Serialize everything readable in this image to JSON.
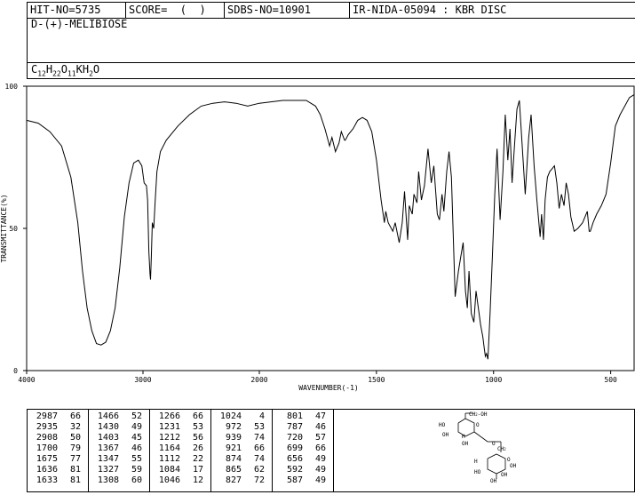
{
  "header": {
    "hit_no": "HIT-NO=5735",
    "score": "SCORE=  (  )",
    "sdbs_no": "SDBS-NO=10901",
    "ir_info": "IR-NIDA-05094 : KBR DISC"
  },
  "compound_name": "D-(+)-MELIBIOSE",
  "formula": {
    "c": "C",
    "c_n": "12",
    "h": "H",
    "h_n": "22",
    "o": "O",
    "o_n": "11",
    "k": "KH",
    "k_n": "2",
    "o2": "O"
  },
  "chart_data": {
    "type": "line",
    "xlabel": "WAVENUMBER(-1)",
    "ylabel": "TRANSMITTANCE(%)",
    "xlim": [
      4000,
      400
    ],
    "ylim": [
      0,
      100
    ],
    "x_ticks": [
      "4000",
      "3000",
      "2000",
      "1500",
      "1000",
      "500"
    ],
    "y_ticks": [
      "100",
      "50",
      "0"
    ],
    "series": [
      {
        "x": [
          4000,
          3900,
          3800,
          3700,
          3620,
          3560,
          3520,
          3480,
          3440,
          3400,
          3360,
          3320,
          3280,
          3240,
          3200,
          3160,
          3120,
          3080,
          3040,
          3010,
          2990,
          2970,
          2960,
          2950,
          2940,
          2935,
          2928,
          2920,
          2908,
          2895,
          2880,
          2850,
          2800,
          2700,
          2600,
          2500,
          2400,
          2300,
          2200,
          2100,
          2000,
          1900,
          1800,
          1760,
          1740,
          1720,
          1710,
          1700,
          1690,
          1675,
          1660,
          1650,
          1636,
          1633,
          1620,
          1600,
          1580,
          1560,
          1540,
          1520,
          1500,
          1480,
          1466,
          1460,
          1450,
          1430,
          1420,
          1403,
          1390,
          1380,
          1367,
          1360,
          1347,
          1340,
          1327,
          1320,
          1308,
          1295,
          1280,
          1266,
          1255,
          1240,
          1231,
          1220,
          1212,
          1200,
          1190,
          1180,
          1164,
          1150,
          1140,
          1130,
          1120,
          1112,
          1105,
          1095,
          1084,
          1075,
          1065,
          1055,
          1046,
          1040,
          1035,
          1030,
          1024,
          1015,
          1005,
          995,
          985,
          972,
          960,
          950,
          939,
          930,
          921,
          910,
          900,
          890,
          874,
          865,
          850,
          840,
          827,
          815,
          801,
          795,
          787,
          780,
          770,
          760,
          750,
          740,
          730,
          720,
          710,
          699,
          690,
          680,
          670,
          656,
          640,
          620,
          600,
          592,
          587,
          575,
          560,
          540,
          520,
          500,
          480,
          460,
          440,
          420,
          400
        ],
        "y": [
          88,
          87,
          84,
          79,
          68,
          52,
          35,
          22,
          14,
          9.5,
          9,
          10,
          14,
          22,
          36,
          54,
          66,
          73,
          74,
          72,
          66,
          65,
          60,
          42,
          34,
          32,
          40,
          52,
          50,
          60,
          70,
          77,
          81,
          86,
          90,
          93,
          94,
          94.5,
          94,
          93,
          94,
          95,
          95,
          93,
          90,
          85,
          82,
          79,
          82,
          77,
          80,
          84,
          81,
          81,
          83,
          85,
          88,
          89,
          88,
          84,
          74,
          60,
          52,
          56,
          52,
          49,
          52,
          45,
          52,
          63,
          46,
          58,
          55,
          62,
          59,
          70,
          60,
          65,
          78,
          66,
          72,
          55,
          53,
          62,
          56,
          70,
          77,
          68,
          26,
          35,
          40,
          45,
          28,
          22,
          35,
          20,
          17,
          28,
          22,
          16,
          12,
          8,
          5,
          6,
          4,
          20,
          40,
          62,
          78,
          53,
          70,
          90,
          74,
          85,
          66,
          80,
          92,
          95,
          74,
          62,
          82,
          90,
          72,
          60,
          47,
          55,
          46,
          60,
          68,
          70,
          71,
          72,
          66,
          57,
          62,
          58,
          66,
          62,
          54,
          49,
          50,
          52,
          56,
          49,
          49,
          52,
          55,
          58,
          62,
          73,
          86,
          90,
          93,
          96,
          97
        ]
      }
    ]
  },
  "peak_table": {
    "columns": [
      [
        [
          "2987",
          "66"
        ],
        [
          "2935",
          "32"
        ],
        [
          "2908",
          "50"
        ],
        [
          "1700",
          "79"
        ],
        [
          "1675",
          "77"
        ],
        [
          "1636",
          "81"
        ],
        [
          "1633",
          "81"
        ]
      ],
      [
        [
          "1466",
          "52"
        ],
        [
          "1430",
          "49"
        ],
        [
          "1403",
          "45"
        ],
        [
          "1367",
          "46"
        ],
        [
          "1347",
          "55"
        ],
        [
          "1327",
          "59"
        ],
        [
          "1308",
          "60"
        ]
      ],
      [
        [
          "1266",
          "66"
        ],
        [
          "1231",
          "53"
        ],
        [
          "1212",
          "56"
        ],
        [
          "1164",
          "26"
        ],
        [
          "1112",
          "22"
        ],
        [
          "1084",
          "17"
        ],
        [
          "1046",
          "12"
        ]
      ],
      [
        [
          "1024",
          "4"
        ],
        [
          "972",
          "53"
        ],
        [
          "939",
          "74"
        ],
        [
          "921",
          "66"
        ],
        [
          "874",
          "74"
        ],
        [
          "865",
          "62"
        ],
        [
          "827",
          "72"
        ]
      ],
      [
        [
          "801",
          "47"
        ],
        [
          "787",
          "46"
        ],
        [
          "720",
          "57"
        ],
        [
          "699",
          "66"
        ],
        [
          "656",
          "49"
        ],
        [
          "592",
          "49"
        ],
        [
          "587",
          "49"
        ]
      ]
    ]
  },
  "structure": {
    "labels": [
      "CH2",
      "OH",
      "O",
      "HO",
      "OH",
      "H",
      "OH",
      "CH2",
      "O",
      "HO",
      "OH",
      "OH",
      "OH",
      "H"
    ]
  }
}
